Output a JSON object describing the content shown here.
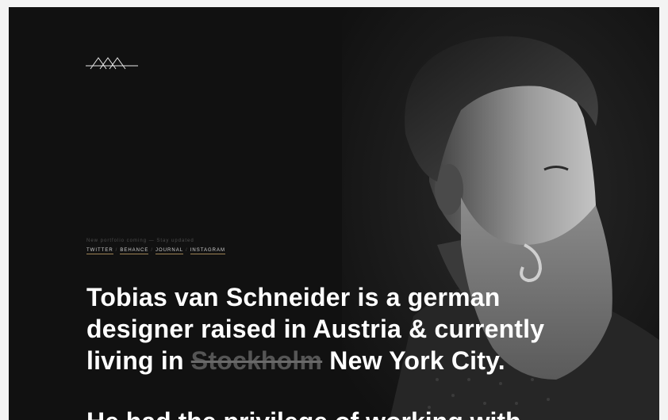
{
  "meta": {
    "tagline": "New portfolio coming — Stay updated",
    "links": [
      "TWITTER",
      "BEHANCE",
      "JOURNAL",
      "INSTAGRAM"
    ],
    "separator": "/"
  },
  "headline": {
    "line1": "Tobias van Schneider is a german",
    "line2": "designer raised in Austria & currently",
    "line3_prefix": "living in",
    "struck_city": "Stockholm",
    "current_city": "New York City."
  },
  "next_paragraph": {
    "partial_text": "He had the privilege of working with"
  },
  "icons": {
    "logo": "mountains-logo-icon"
  },
  "colors": {
    "background": "#111111",
    "text": "#ffffff",
    "muted": "#555555",
    "link_underline": "#a08456"
  }
}
